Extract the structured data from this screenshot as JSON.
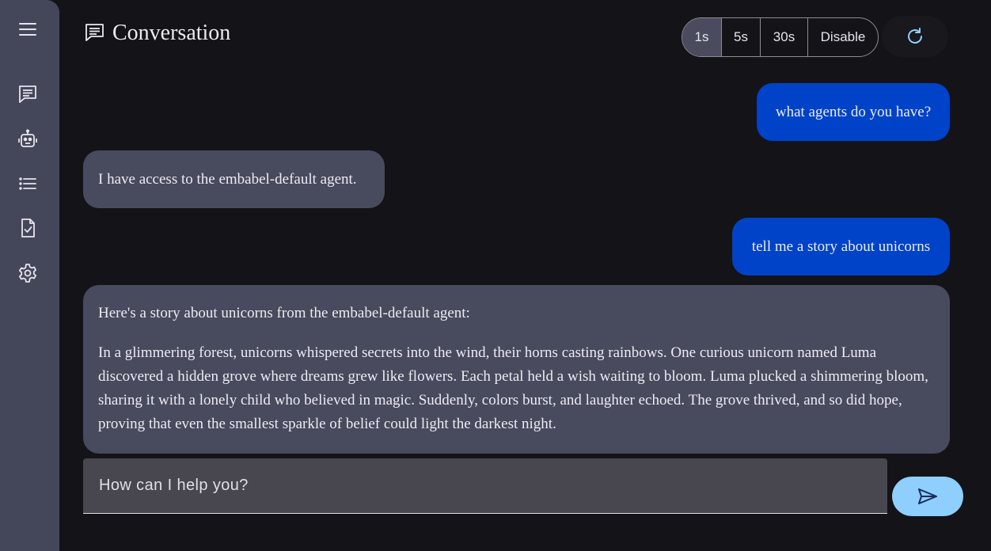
{
  "header": {
    "title": "Conversation",
    "title_icon": "chat-icon"
  },
  "refresh_options": [
    {
      "label": "1s",
      "active": true
    },
    {
      "label": "5s",
      "active": false
    },
    {
      "label": "30s",
      "active": false
    },
    {
      "label": "Disable",
      "active": false
    }
  ],
  "sidebar": {
    "items": [
      {
        "icon": "menu-icon"
      },
      {
        "icon": "chat-icon"
      },
      {
        "icon": "robot-icon"
      },
      {
        "icon": "list-icon"
      },
      {
        "icon": "clipboard-check-icon"
      },
      {
        "icon": "gear-icon"
      }
    ]
  },
  "messages": [
    {
      "role": "user",
      "text": "what agents do you have?"
    },
    {
      "role": "agent",
      "paragraphs": [
        "I have access to the embabel-default agent."
      ]
    },
    {
      "role": "user",
      "text": "tell me a story about unicorns"
    },
    {
      "role": "agent",
      "paragraphs": [
        "Here's a story about unicorns from the embabel-default agent:",
        "In a glimmering forest, unicorns whispered secrets into the wind, their horns casting rainbows. One curious unicorn named Luma discovered a hidden grove where dreams grew like flowers. Each petal held a wish waiting to bloom. Luma plucked a shimmering bloom, sharing it with a lonely child who believed in magic. Suddenly, colors burst, and laughter echoed. The grove thrived, and so did hope, proving that even the smallest sparkle of belief could light the darkest night."
      ]
    }
  ],
  "composer": {
    "placeholder": "How can I help you?",
    "value": ""
  },
  "colors": {
    "background": "#141317",
    "sidebar": "#44475a",
    "user_bubble": "#0043c8",
    "agent_bubble": "#484a5e",
    "accent": "#8ecffd"
  }
}
